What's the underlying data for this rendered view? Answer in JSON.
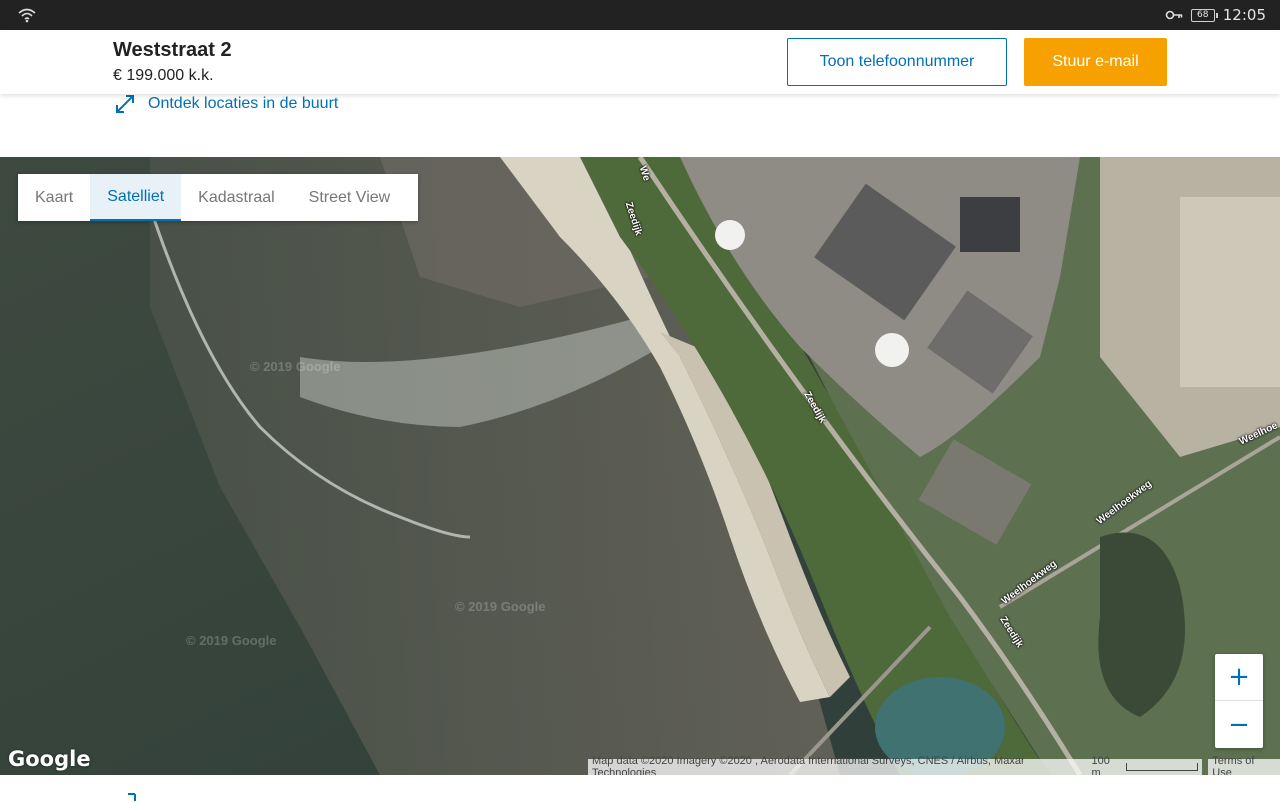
{
  "status_bar": {
    "time": "12:05",
    "battery": "68",
    "icons": [
      "wifi-icon",
      "key-icon",
      "battery-icon"
    ]
  },
  "listing": {
    "title": "Weststraat 2",
    "price": "€ 199.000 k.k.",
    "phone_button": "Toon telefoonnummer",
    "email_button": "Stuur e-mail",
    "nearby_link": "Ontdek locaties in de buurt"
  },
  "map": {
    "tabs": [
      "Kaart",
      "Satelliet",
      "Kadastraal",
      "Street View"
    ],
    "active_tab": "Satelliet",
    "road_labels": {
      "zeedijk_top": "Zeedijk",
      "zeedijk_mid": "Zeedijk",
      "zeedijk_low": "Zeedijk",
      "weelhoekweg_1": "Weelhoekweg",
      "weelhoekweg_2": "Weelhoekweg",
      "weelhoe": "Weelhoe",
      "wes": "We"
    },
    "watermarks": [
      "© 2019 Google",
      "© 2019 Google",
      "© 2019 Google"
    ],
    "zoom_in": "+",
    "zoom_out": "−",
    "google_logo": "Google",
    "attribution": "Map data ©2020 Imagery ©2020 , Aerodata International Surveys, CNES / Airbus, Maxar Technologies",
    "scale": "100 m",
    "terms": "Terms of Use"
  },
  "colors": {
    "brand_blue": "#0071b3",
    "accent_orange": "#f7a100"
  }
}
